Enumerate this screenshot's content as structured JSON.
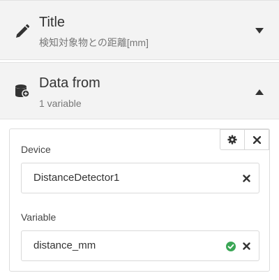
{
  "title_section": {
    "heading": "Title",
    "value": "検知対象物との距離[mm]",
    "icon": "pencil-icon",
    "state": "collapsed"
  },
  "data_section": {
    "heading": "Data from",
    "summary": "1 variable",
    "icon": "database-icon",
    "state": "expanded"
  },
  "variable_card": {
    "tools": [
      "gear-icon",
      "close-icon"
    ],
    "device": {
      "label": "Device",
      "value": "DistanceDetector1"
    },
    "variable": {
      "label": "Variable",
      "value": "distance_mm",
      "status": "ok"
    }
  },
  "colors": {
    "section_bg": "#f3f3f3",
    "text": "#333333",
    "muted": "#777777",
    "ok_green": "#3aa655"
  }
}
